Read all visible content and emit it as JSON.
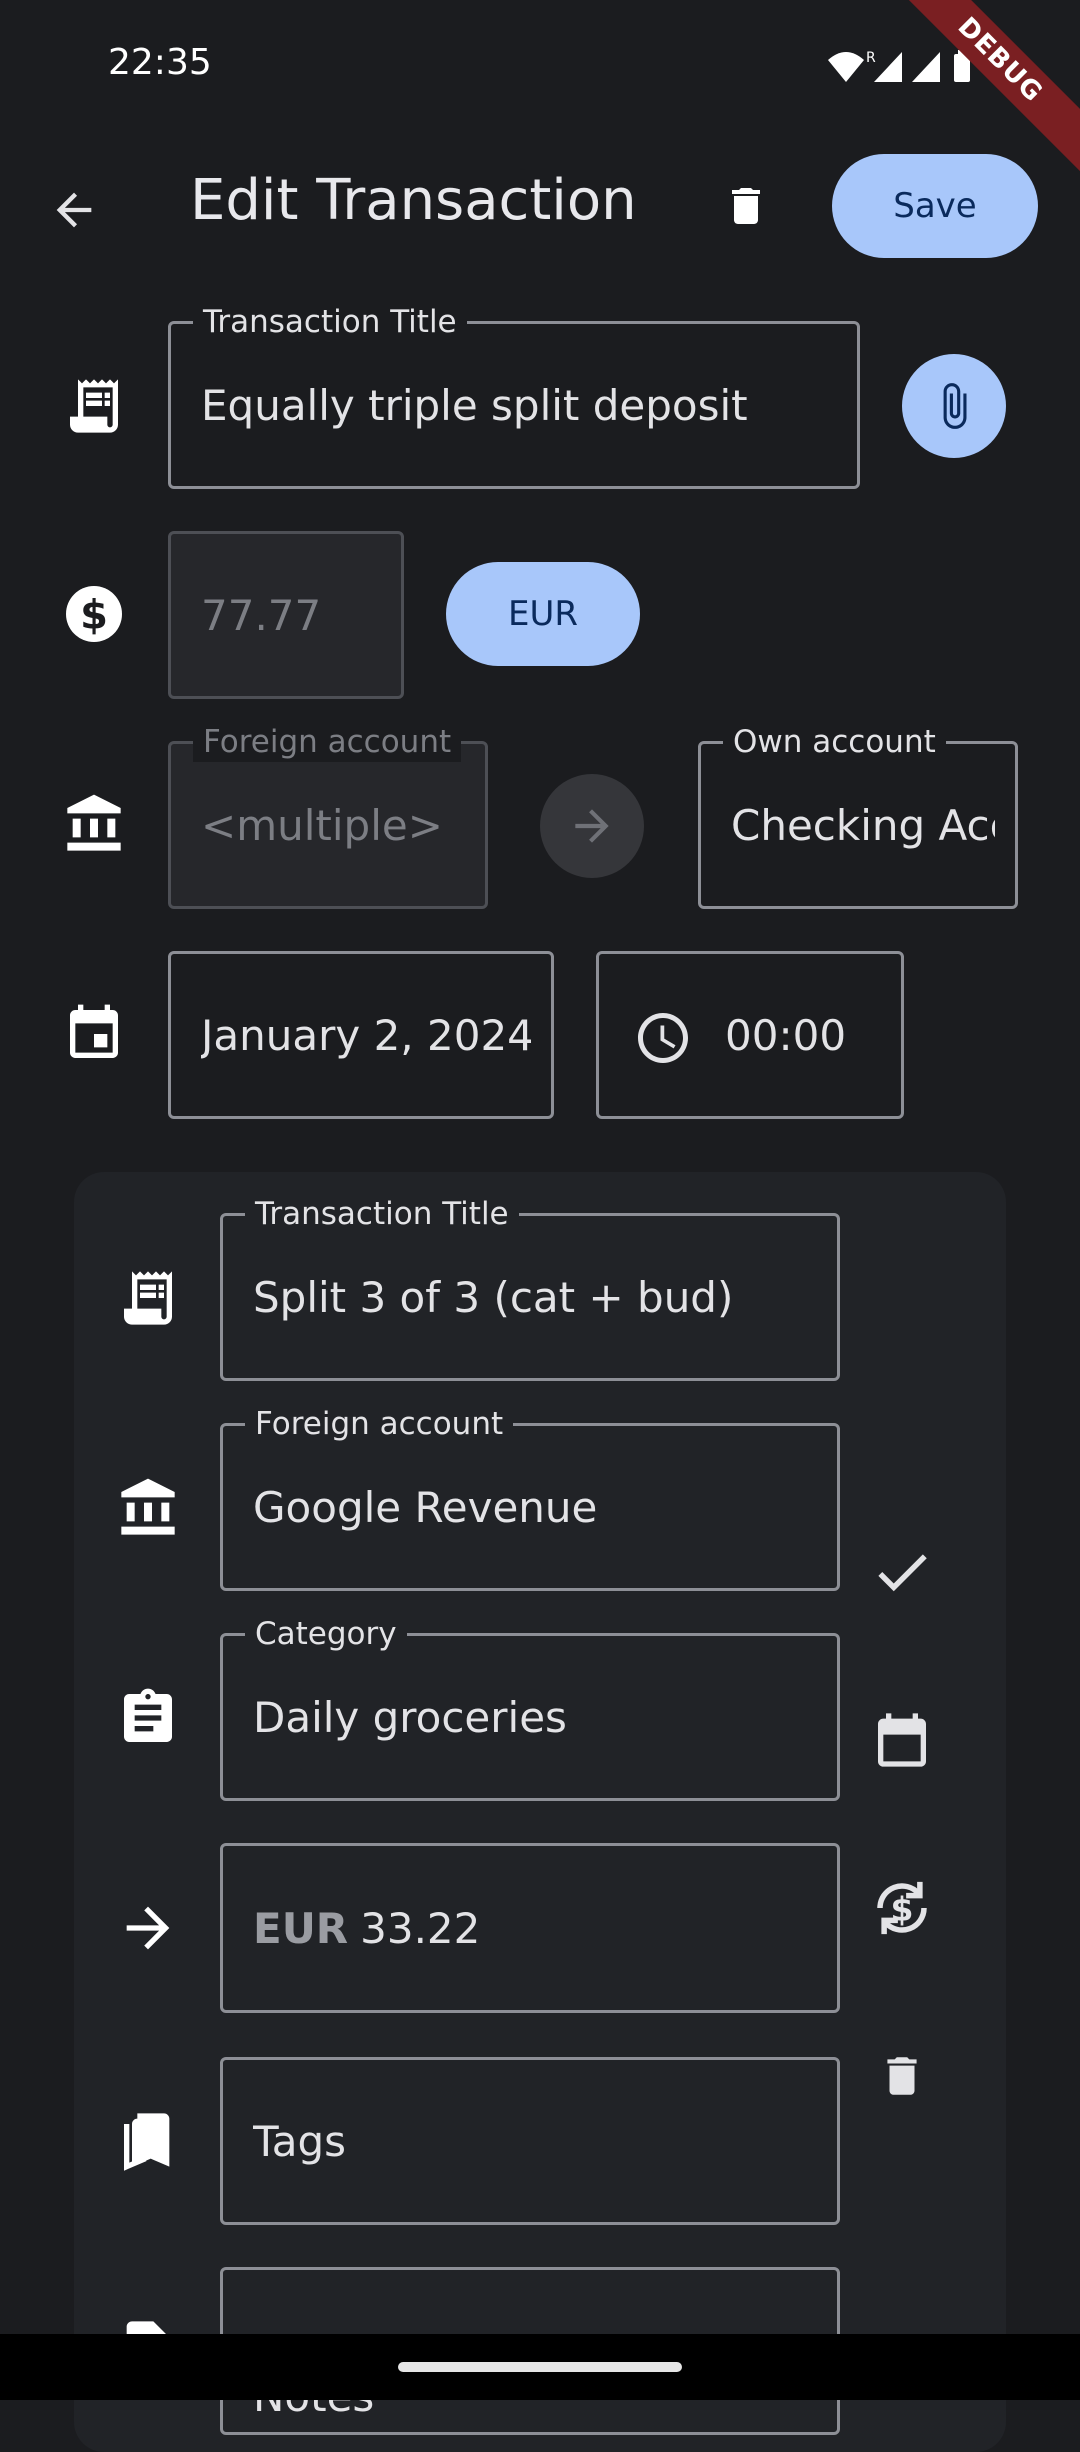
{
  "status_bar": {
    "time": "22:35",
    "icons": [
      "wifi-icon",
      "roaming-r-icon",
      "signal-icon",
      "signal-icon",
      "battery-icon"
    ]
  },
  "debug_banner": "DEBUG",
  "app_bar": {
    "title": "Edit Transaction",
    "save_label": "Save",
    "back_icon": "arrow-back-icon",
    "delete_icon": "trash-icon"
  },
  "form": {
    "title_label": "Transaction Title",
    "title_value": "Equally triple split deposit",
    "amount_value": "77.77",
    "currency": "EUR",
    "foreign_account_label": "Foreign account",
    "foreign_account_value": "<multiple>",
    "own_account_label": "Own account",
    "own_account_value": "Checking Account",
    "date_value": "January 2, 2024",
    "time_value": "00:00"
  },
  "split_card": {
    "title_label": "Transaction Title",
    "title_value": "Split 3 of 3 (cat + bud)",
    "foreign_account_label": "Foreign account",
    "foreign_account_value": "Google Revenue",
    "category_label": "Category",
    "category_value": "Daily groceries",
    "amount_currency": "EUR",
    "amount_value": "33.22",
    "tags_value": "Tags",
    "notes_value": "Notes"
  },
  "colors": {
    "background": "#1b1c1f",
    "card": "#212327",
    "accent": "#a8c7fa",
    "accent_text": "#0a2a5c"
  }
}
